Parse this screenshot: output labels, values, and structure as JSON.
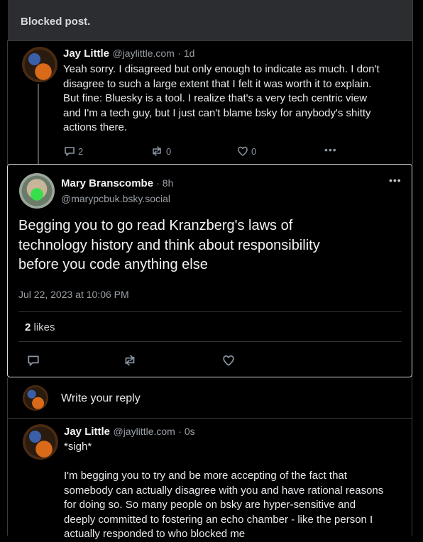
{
  "blocked_banner": {
    "label": "Blocked post."
  },
  "parent_post": {
    "author_name": "Jay Little",
    "author_handle": "@jaylittle.com",
    "age": "· 1d",
    "text_lines": [
      "Yeah sorry. I disagreed but only enough to indicate as much.  I don't",
      "disagree to such a large extent that I felt it was worth it to explain.",
      "But fine:  Bluesky is a tool. I realize that's a very tech centric view",
      "and I'm a tech guy, but I just can't blame bsky for anybody's shitty",
      "actions there."
    ],
    "reply_count": "2",
    "repost_count": "0",
    "like_count": "0"
  },
  "focused_post": {
    "author_name": "Mary Branscombe",
    "age": "· 8h",
    "author_handle": "@marypcbuk.bsky.social",
    "text_lines": [
      "Begging you to go read Kranzberg's laws of",
      "technology history and think about responsibility",
      "before you code anything else"
    ],
    "timestamp": "Jul 22, 2023 at 10:06 PM",
    "likes_count": "2",
    "likes_label": "likes"
  },
  "reply_composer": {
    "placeholder": "Write your reply"
  },
  "reply_post": {
    "author_name": "Jay Little",
    "author_handle": "@jaylittle.com",
    "age": "· 0s",
    "text_lines": [
      "*sigh*",
      "",
      "I'm begging you to try and be more accepting of the fact that",
      "somebody can actually disagree with you and have rational reasons",
      "for doing so.  So many people on bsky are hyper-sensitive and",
      "deeply committed to fostering an echo chamber - like the person I",
      "actually responded to who blocked me"
    ]
  },
  "colors": {
    "accent_green": "#37e04b",
    "border_focus": "#d9dde1",
    "muted": "#9aa0a6"
  },
  "icons": [
    "reply-icon",
    "repost-icon",
    "like-icon",
    "more-icon",
    "avatar"
  ]
}
